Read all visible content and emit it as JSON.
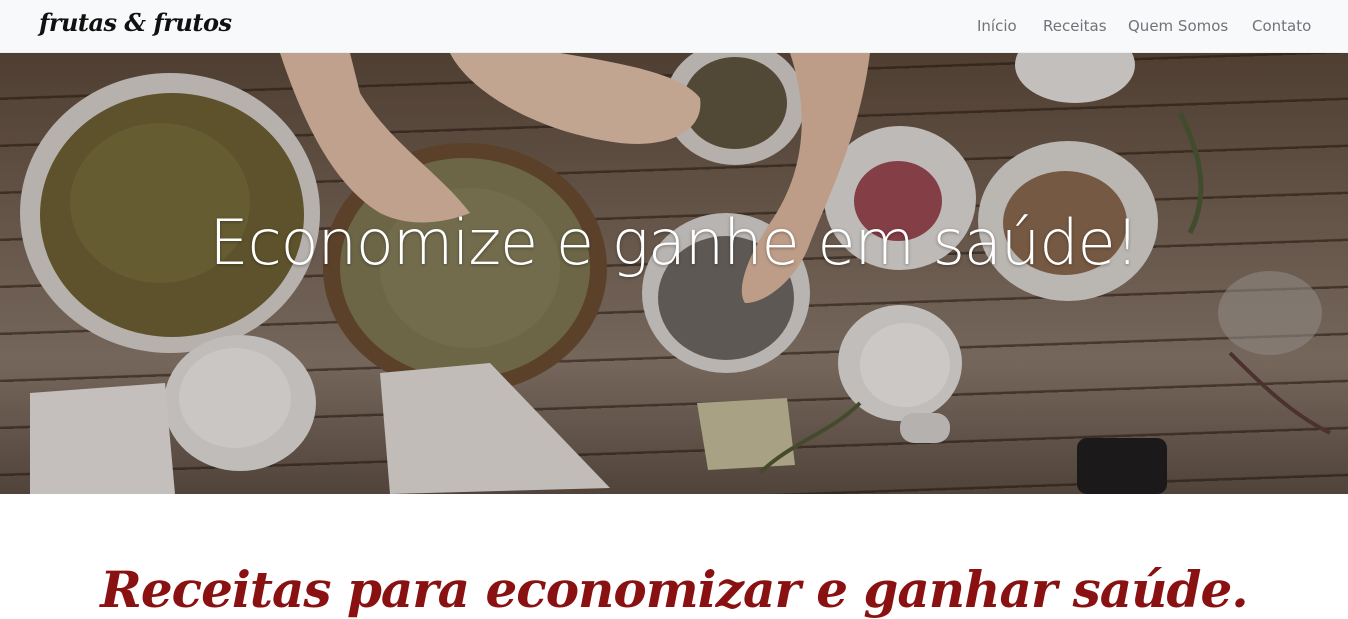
{
  "navbar": {
    "brand": "frutas & frutos",
    "links": [
      "Início",
      "Receitas",
      "Quem Somos",
      "Contato"
    ]
  },
  "hero": {
    "title": "Economize e ganhe em saúde!"
  },
  "section": {
    "title": "Receitas para economizar e ganhar saúde."
  },
  "colors": {
    "navbar_bg": "#f8f9fa",
    "nav_link": "#707478",
    "section_title": "#8a1111",
    "hero_text": "#ffffff"
  }
}
